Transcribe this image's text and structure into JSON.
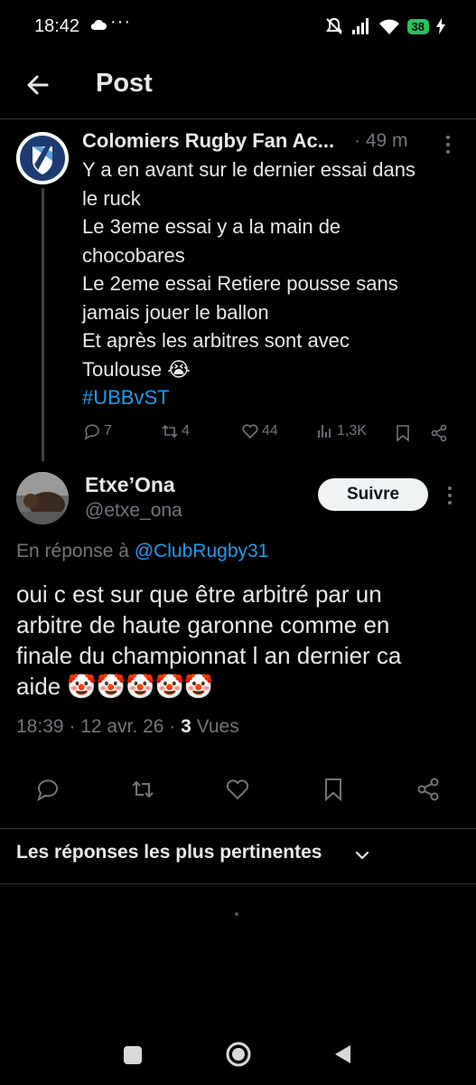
{
  "status_bar": {
    "time": "18:42",
    "dots": "···",
    "battery": "38"
  },
  "header": {
    "title": "Post"
  },
  "parent_tweet": {
    "author_name": "Colomiers Rugby Fan Ac...",
    "time_ago": "· 49 m",
    "text_lines": [
      "Y a en avant sur le dernier essai dans",
      "le ruck",
      "Le 3eme essai y a la main de",
      "chocobares",
      "Le 2eme essai Retiere pousse sans",
      "jamais jouer le ballon",
      "Et après les arbitres sont avec",
      "Toulouse 😭"
    ],
    "hashtag": "#UBBvST",
    "stats": {
      "replies": "7",
      "reposts": "4",
      "likes": "44",
      "views": "1,3K"
    }
  },
  "main_tweet": {
    "author_name": "Etxe’Ona",
    "handle": "@etxe_ona",
    "follow_label": "Suivre",
    "reply_prefix": "En réponse à",
    "reply_mention": "@ClubRugby31",
    "text_lines": [
      "oui c est sur que être arbitré par un",
      "arbitre de haute garonne comme en",
      "finale du championnat l an dernier ca",
      "aide 🤡🤡🤡🤡🤡"
    ],
    "meta_time": "18:39 · 12 avr. 26 · ",
    "meta_views_count": "3",
    "meta_views_label": " Vues"
  },
  "sort": {
    "label": "Les réponses les plus pertinentes"
  },
  "colors": {
    "background": "#000000",
    "text_primary": "#e7e9ea",
    "text_secondary": "#71767b",
    "link": "#1d9bf0",
    "divider": "#2f3336",
    "battery": "#22c55e"
  }
}
